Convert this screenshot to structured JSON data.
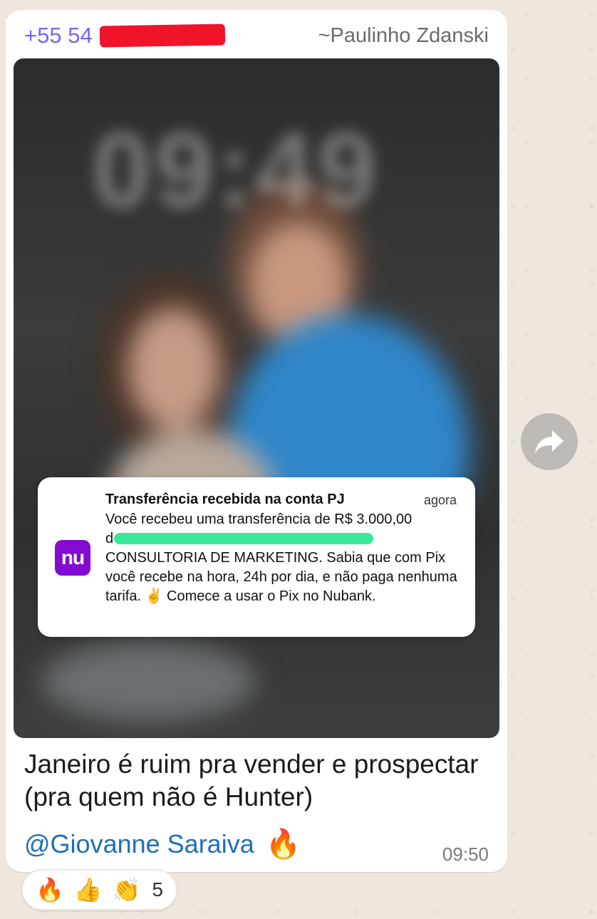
{
  "message": {
    "sender_phone": "+55 54",
    "sender_name": "~Paulinho Zdanski",
    "image": {
      "clock_overlay": "09:49",
      "notification": {
        "title": "Transferência recebida na conta PJ",
        "time": "agora",
        "line1": "Você recebeu uma transferência de R$ 3.000,00",
        "line2_prefix": "d",
        "body_rest": "CONSULTORIA DE MARKETING. Sabia que com Pix você recebe na hora, 24h por dia, e não paga nenhuma tarifa. ✌️ Comece a usar o Pix no Nubank.",
        "app_icon_text": "nu",
        "app_icon_color": "#820ad1"
      }
    },
    "caption": "Janeiro é ruim pra vender e prospectar (pra quem não é Hunter)",
    "mention": "@Giovanne Saraiva",
    "mention_emoji": "🔥",
    "time": "09:50"
  },
  "reactions": {
    "emojis": [
      "🔥",
      "👍",
      "👏"
    ],
    "count": "5"
  },
  "colors": {
    "sender_phone": "#7b61ff",
    "mention": "#1f6fb5",
    "redaction_red": "#f0142a",
    "redaction_green": "#39e89a"
  },
  "icons": {
    "forward": "forward-arrow-icon"
  }
}
